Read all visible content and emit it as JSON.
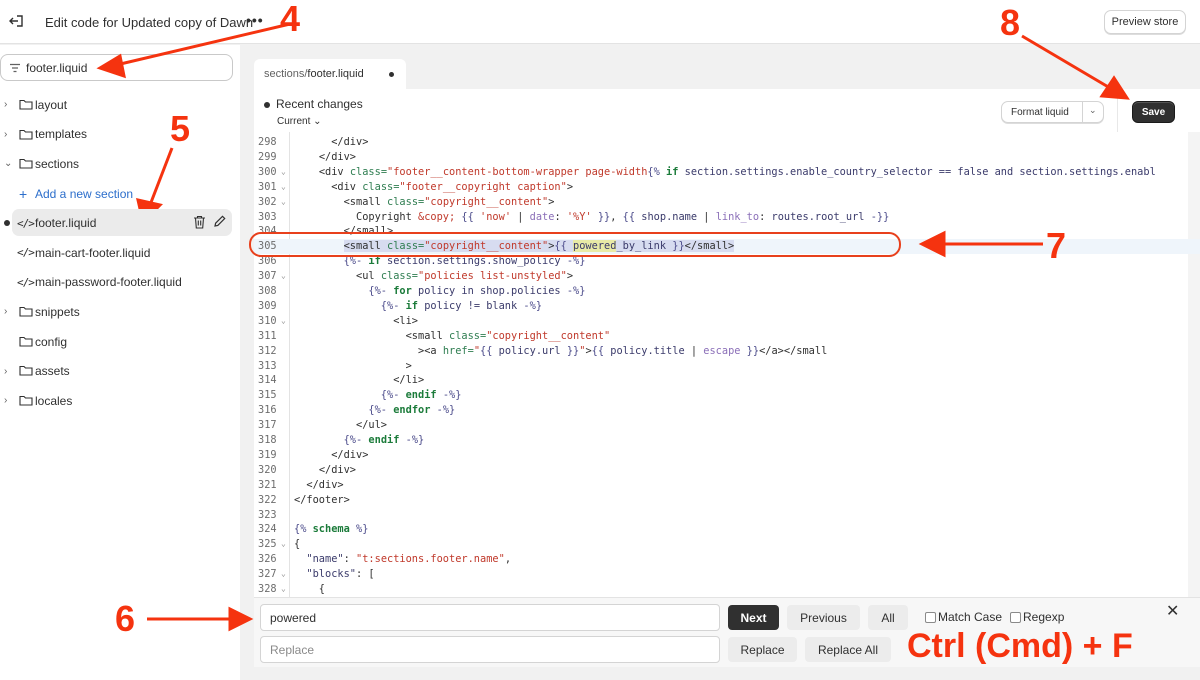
{
  "topbar": {
    "title": "Edit code for Updated copy of Dawn",
    "more_label": "•••",
    "preview_label": "Preview store"
  },
  "sidebar": {
    "search_value": "footer.liquid",
    "tree": [
      {
        "type": "folder",
        "label": "layout",
        "expanded": false
      },
      {
        "type": "folder",
        "label": "templates",
        "expanded": false
      },
      {
        "type": "folder",
        "label": "sections",
        "expanded": true
      },
      {
        "type": "add",
        "label": "Add a new section"
      },
      {
        "type": "file",
        "label": "footer.liquid",
        "active": true,
        "modified": true
      },
      {
        "type": "file",
        "label": "main-cart-footer.liquid"
      },
      {
        "type": "file",
        "label": "main-password-footer.liquid"
      },
      {
        "type": "folder",
        "label": "snippets",
        "expanded": false
      },
      {
        "type": "folder",
        "label": "config",
        "expanded": null
      },
      {
        "type": "folder",
        "label": "assets",
        "expanded": false
      },
      {
        "type": "folder",
        "label": "locales",
        "expanded": false
      }
    ]
  },
  "editor": {
    "tab_path": "sections/",
    "tab_file": "footer.liquid",
    "recent_changes": "Recent changes",
    "current_label": "Current",
    "format_label": "Format liquid",
    "save_label": "Save",
    "highlighted_line": 305,
    "lines": [
      {
        "n": 298,
        "fold": false,
        "html": "      <span class='t-tag'>&lt;/div&gt;</span>"
      },
      {
        "n": 299,
        "fold": false,
        "html": "    <span class='t-tag'>&lt;/div&gt;</span>"
      },
      {
        "n": 300,
        "fold": true,
        "html": "    <span class='t-tag'>&lt;div</span> <span class='t-attr'>class=</span><span class='t-str'>\"footer__content-bottom-wrapper page-width</span><span class='t-delim'>{%</span> <span class='t-kw'>if</span> <span class='t-var'>section.settings.enable_country_selector == </span><span class='t-var'>false and section.settings.enabl</span>"
      },
      {
        "n": 301,
        "fold": true,
        "html": "      <span class='t-tag'>&lt;div</span> <span class='t-attr'>class=</span><span class='t-str'>\"footer__copyright caption\"</span><span class='t-tag'>&gt;</span>"
      },
      {
        "n": 302,
        "fold": true,
        "html": "        <span class='t-tag'>&lt;small</span> <span class='t-attr'>class=</span><span class='t-str'>\"copyright__content\"</span><span class='t-tag'>&gt;</span>"
      },
      {
        "n": 303,
        "fold": false,
        "html": "          Copyright <span class='t-str'>&amp;copy;</span> <span class='t-delim'>{{</span> <span class='t-str'>'now'</span> | <span class='t-filter'>date</span>: <span class='t-str'>'%Y'</span> <span class='t-delim'>}}</span>, <span class='t-delim'>{{</span> <span class='t-var'>shop.name</span> | <span class='t-filter'>link_to</span>: <span class='t-var'>routes.root_url</span> <span class='t-delim'>-}}</span>"
      },
      {
        "n": 304,
        "fold": false,
        "html": "        <span class='t-tag'>&lt;/small&gt;</span>"
      },
      {
        "n": 305,
        "fold": false,
        "html": "        <span class='sel'><span class='t-tag'>&lt;small</span> <span class='t-attr'>class=</span><span class='t-str'>\"copyright__content\"</span><span class='t-tag'>&gt;</span><span class='t-delim'>{{</span> <span class='match'><span class='t-var'>powered</span></span><span class='t-var'>_by_link</span> <span class='t-delim'>}}</span><span class='t-tag'>&lt;/small&gt;</span></span>"
      },
      {
        "n": 306,
        "fold": false,
        "html": "        <span class='t-delim'>{%-</span> <span class='t-kw'>if</span> <span class='t-var'>section.settings.show_policy</span> <span class='t-delim'>-%}</span>"
      },
      {
        "n": 307,
        "fold": true,
        "html": "          <span class='t-tag'>&lt;ul</span> <span class='t-attr'>class=</span><span class='t-str'>\"policies list-unstyled\"</span><span class='t-tag'>&gt;</span>"
      },
      {
        "n": 308,
        "fold": false,
        "html": "            <span class='t-delim'>{%-</span> <span class='t-kw'>for</span> <span class='t-var'>policy in shop.policies</span> <span class='t-delim'>-%}</span>"
      },
      {
        "n": 309,
        "fold": false,
        "html": "              <span class='t-delim'>{%-</span> <span class='t-kw'>if</span> <span class='t-var'>policy != blank</span> <span class='t-delim'>-%}</span>"
      },
      {
        "n": 310,
        "fold": true,
        "html": "                <span class='t-tag'>&lt;li&gt;</span>"
      },
      {
        "n": 311,
        "fold": false,
        "html": "                  <span class='t-tag'>&lt;small</span> <span class='t-attr'>class=</span><span class='t-str'>\"copyright__content\"</span>"
      },
      {
        "n": 312,
        "fold": false,
        "html": "                    <span class='t-tag'>&gt;&lt;a</span> <span class='t-attr'>href=</span><span class='t-str'>\"</span><span class='t-delim'>{{</span> <span class='t-var'>policy.url</span> <span class='t-delim'>}}</span><span class='t-str'>\"</span><span class='t-tag'>&gt;</span><span class='t-delim'>{{</span> <span class='t-var'>policy.title</span> | <span class='t-filter'>escape</span> <span class='t-delim'>}}</span><span class='t-tag'>&lt;/a&gt;&lt;/small</span>"
      },
      {
        "n": 313,
        "fold": false,
        "html": "                  <span class='t-tag'>&gt;</span>"
      },
      {
        "n": 314,
        "fold": false,
        "html": "                <span class='t-tag'>&lt;/li&gt;</span>"
      },
      {
        "n": 315,
        "fold": false,
        "html": "              <span class='t-delim'>{%-</span> <span class='t-kw'>endif</span> <span class='t-delim'>-%}</span>"
      },
      {
        "n": 316,
        "fold": false,
        "html": "            <span class='t-delim'>{%-</span> <span class='t-kw'>endfor</span> <span class='t-delim'>-%}</span>"
      },
      {
        "n": 317,
        "fold": false,
        "html": "          <span class='t-tag'>&lt;/ul&gt;</span>"
      },
      {
        "n": 318,
        "fold": false,
        "html": "        <span class='t-delim'>{%-</span> <span class='t-kw'>endif</span> <span class='t-delim'>-%}</span>"
      },
      {
        "n": 319,
        "fold": false,
        "html": "      <span class='t-tag'>&lt;/div&gt;</span>"
      },
      {
        "n": 320,
        "fold": false,
        "html": "    <span class='t-tag'>&lt;/div&gt;</span>"
      },
      {
        "n": 321,
        "fold": false,
        "html": "  <span class='t-tag'>&lt;/div&gt;</span>"
      },
      {
        "n": 322,
        "fold": false,
        "html": "<span class='t-tag'>&lt;/footer&gt;</span>"
      },
      {
        "n": 323,
        "fold": false,
        "html": ""
      },
      {
        "n": 324,
        "fold": false,
        "html": "<span class='t-delim'>{%</span> <span class='t-kw'>schema</span> <span class='t-delim'>%}</span>"
      },
      {
        "n": 325,
        "fold": true,
        "html": "{"
      },
      {
        "n": 326,
        "fold": false,
        "html": "  <span class='t-var'>\"name\"</span>: <span class='t-str'>\"t:sections.footer.name\"</span>,"
      },
      {
        "n": 327,
        "fold": true,
        "html": "  <span class='t-var'>\"blocks\"</span>: ["
      },
      {
        "n": 328,
        "fold": true,
        "html": "    {"
      }
    ]
  },
  "findbar": {
    "find_value": "powered",
    "replace_placeholder": "Replace",
    "next_label": "Next",
    "previous_label": "Previous",
    "all_label": "All",
    "match_case_label": "Match Case",
    "regexp_label": "Regexp",
    "replace_label": "Replace",
    "replace_all_label": "Replace All",
    "close_label": "✕"
  },
  "annotations": {
    "step4": "4",
    "step5": "5",
    "step6": "6",
    "step7": "7",
    "step8": "8",
    "shortcut": "Ctrl (Cmd) + F",
    "color": "#f5330f"
  }
}
